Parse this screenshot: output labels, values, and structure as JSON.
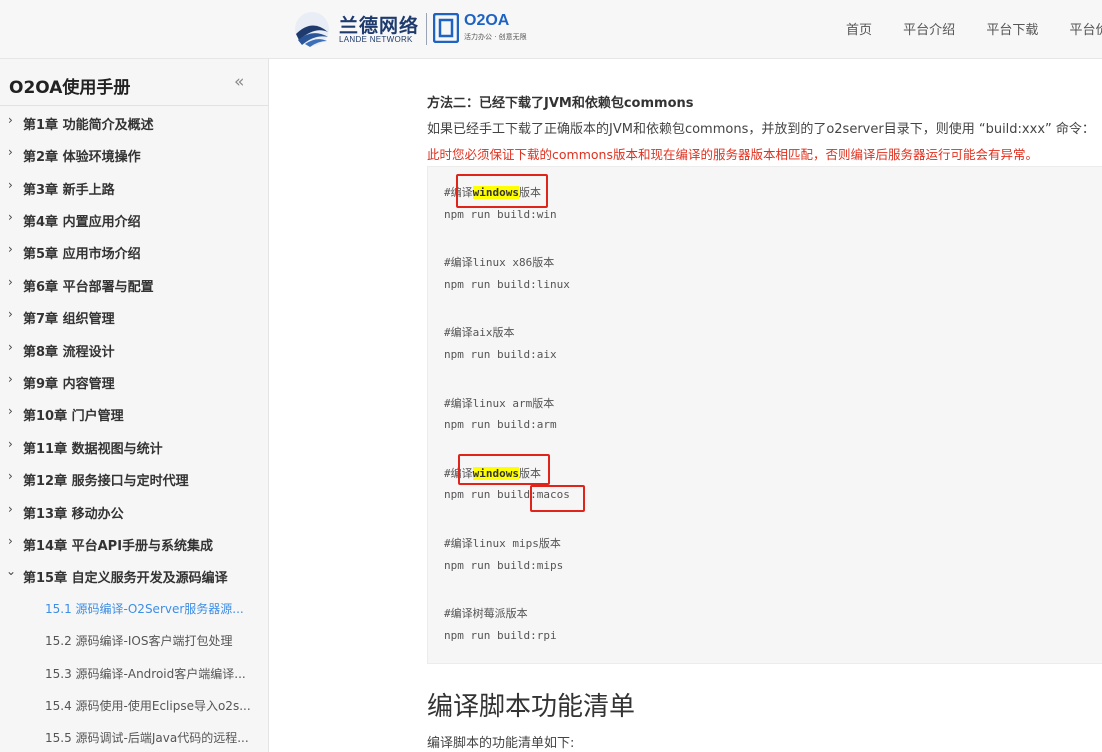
{
  "header": {
    "brand_name": "兰德网络",
    "brand_sub": "LANDE NETWORK",
    "product_name": "O2OA",
    "product_slogan": "活力办公 · 创意无限",
    "nav": [
      "首页",
      "平台介绍",
      "平台下载",
      "平台价"
    ]
  },
  "sidebar": {
    "title": "O2OA使用手册",
    "collapse_icon": "«",
    "chapters": [
      "第1章 功能简介及概述",
      "第2章 体验环境操作",
      "第3章 新手上路",
      "第4章 内置应用介绍",
      "第5章 应用市场介绍",
      "第6章 平台部署与配置",
      "第7章 组织管理",
      "第8章 流程设计",
      "第9章 内容管理",
      "第10章 门户管理",
      "第11章 数据视图与统计",
      "第12章 服务接口与定时代理",
      "第13章 移动办公",
      "第14章 平台API手册与系统集成",
      "第15章 自定义服务开发及源码编译"
    ],
    "sub_items": [
      "15.1 源码编译-O2Server服务器源...",
      "15.2 源码编译-IOS客户端打包处理",
      "15.3 源码编译-Android客户端编译...",
      "15.4 源码使用-使用Eclipse导入o2s...",
      "15.5 源码调试-后端Java代码的远程..."
    ]
  },
  "content": {
    "method_title": "方法二：已经下载了JVM和依赖包commons",
    "description": "如果已经手工下载了正确版本的JVM和依赖包commons，并放到的了o2server目录下，则使用 “build:xxx” 命令：",
    "warning": "此时您必须保证下载的commons版本和现在编译的服务器版本相匹配，否则编译后服务器运行可能会有异常。",
    "code": {
      "c1_pre": "#编译",
      "c1_hl": "windows",
      "c1_post": "版本",
      "l1": "npm run build:win",
      "c2": "#编译linux x86版本",
      "l2": "npm run build:linux",
      "c3": "#编译aix版本",
      "l3": "npm run build:aix",
      "c4": "#编译linux arm版本",
      "l4": "npm run build:arm",
      "c5_pre": "#编译",
      "c5_hl": "windows",
      "c5_post": "版本",
      "l5_pre": "npm run build:",
      "l5_tail": "macos",
      "c6": "#编译linux mips版本",
      "l6": "npm run build:mips",
      "c7": "#编译树莓派版本",
      "l7": "npm run build:rpi"
    },
    "section_heading": "编译脚本功能清单",
    "section_desc": "编译脚本的功能清单如下:"
  }
}
